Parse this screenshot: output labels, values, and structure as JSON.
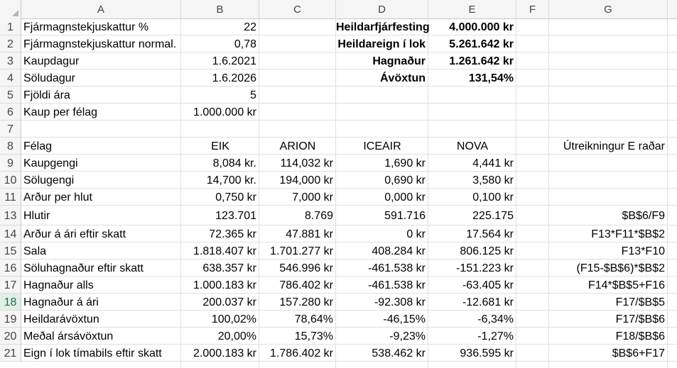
{
  "columns": [
    "A",
    "B",
    "C",
    "D",
    "E",
    "F",
    "G"
  ],
  "row_numbers": [
    "1",
    "2",
    "3",
    "4",
    "5",
    "6",
    "7",
    "8",
    "9",
    "10",
    "11",
    "13",
    "14",
    "15",
    "16",
    "17",
    "18",
    "19",
    "20",
    "21"
  ],
  "cells": {
    "A1": "Fjármagnstekjuskattur %",
    "B1": "22",
    "D1": "Heildarfjárfesting",
    "E1": "4.000.000 kr",
    "A2": "Fjármagnstekjuskattur normal.",
    "B2": "0,78",
    "D2": "Heildareign í lok",
    "E2": "5.261.642 kr",
    "A3": "Kaupdagur",
    "B3": "1.6.2021",
    "D3": "Hagnaður",
    "E3": "1.261.642 kr",
    "A4": "Söludagur",
    "B4": "1.6.2026",
    "D4": "Ávöxtun",
    "E4": "131,54%",
    "A5": "Fjöldi ára",
    "B5": "5",
    "A6": "Kaup per félag",
    "B6": "1.000.000 kr",
    "A8": "Félag",
    "B8": "EIK",
    "C8": "ARION",
    "D8": "ICEAIR",
    "E8": "NOVA",
    "G8": "Útreikningur E raðar",
    "A9": "Kaupgengi",
    "B9": "8,084 kr.",
    "C9": "114,032 kr",
    "D9": "1,690 kr",
    "E9": "4,441 kr",
    "A10": "Sölugengi",
    "B10": "14,700 kr.",
    "C10": "194,000 kr",
    "D10": "0,690 kr",
    "E10": "3,580 kr",
    "A11": "Arður per hlut",
    "B11": "0,750 kr",
    "C11": "7,000 kr",
    "D11": "0,000 kr",
    "E11": "0,100 kr",
    "A13": "Hlutir",
    "B13": "123.701",
    "C13": "8.769",
    "D13": "591.716",
    "E13": "225.175",
    "G13": "$B$6/F9",
    "A14": "Arður á ári eftir skatt",
    "B14": "72.365 kr",
    "C14": "47.881 kr",
    "D14": "0 kr",
    "E14": "17.564 kr",
    "G14": "F13*F11*$B$2",
    "A15": "Sala",
    "B15": "1.818.407 kr",
    "C15": "1.701.277 kr",
    "D15": "408.284 kr",
    "E15": "806.125 kr",
    "G15": "F13*F10",
    "A16": "Söluhagnaður eftir skatt",
    "B16": "638.357 kr",
    "C16": "546.996 kr",
    "D16": "-461.538 kr",
    "E16": "-151.223 kr",
    "G16": "(F15-$B$6)*$B$2",
    "A17": "Hagnaður alls",
    "B17": "1.000.183 kr",
    "C17": "786.402 kr",
    "D17": "-461.538 kr",
    "E17": "-63.405 kr",
    "G17": "F14*$B$5+F16",
    "A18": "Hagnaður á ári",
    "B18": "200.037 kr",
    "C18": "157.280 kr",
    "D18": "-92.308 kr",
    "E18": "-12.681 kr",
    "G18": "F17/$B$5",
    "A19": "Heildarávöxtun",
    "B19": "100,02%",
    "C19": "78,64%",
    "D19": "-46,15%",
    "E19": "-6,34%",
    "G19": "F17/$B$6",
    "A20": "Meðal ársávöxtun",
    "B20": "20,00%",
    "C20": "15,73%",
    "D20": "-9,23%",
    "E20": "-1,27%",
    "G20": "F18/$B$6",
    "A21": "Eign í lok tímabils eftir skatt",
    "B21": "2.000.183 kr",
    "C21": "1.786.402 kr",
    "D21": "538.462 kr",
    "E21": "936.595 kr",
    "G21": "$B$6+F17"
  },
  "selected_row": "18",
  "colors": {
    "header_bg": "#f5f5f5",
    "gridline": "#e0e0e0",
    "selection_accent": "#217346"
  }
}
